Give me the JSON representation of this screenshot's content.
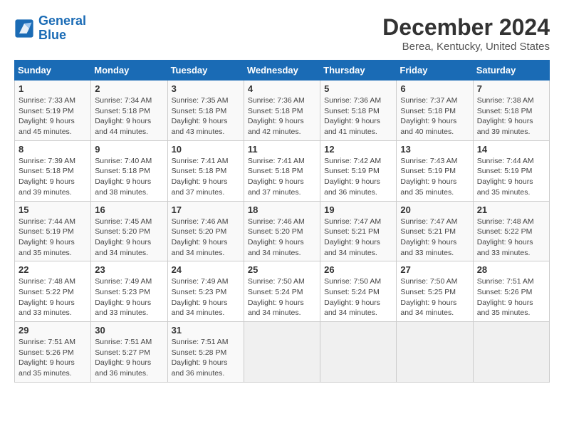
{
  "logo": {
    "line1": "General",
    "line2": "Blue"
  },
  "title": "December 2024",
  "subtitle": "Berea, Kentucky, United States",
  "days_header": [
    "Sunday",
    "Monday",
    "Tuesday",
    "Wednesday",
    "Thursday",
    "Friday",
    "Saturday"
  ],
  "weeks": [
    [
      {
        "day": "1",
        "info": "Sunrise: 7:33 AM\nSunset: 5:19 PM\nDaylight: 9 hours and 45 minutes."
      },
      {
        "day": "2",
        "info": "Sunrise: 7:34 AM\nSunset: 5:18 PM\nDaylight: 9 hours and 44 minutes."
      },
      {
        "day": "3",
        "info": "Sunrise: 7:35 AM\nSunset: 5:18 PM\nDaylight: 9 hours and 43 minutes."
      },
      {
        "day": "4",
        "info": "Sunrise: 7:36 AM\nSunset: 5:18 PM\nDaylight: 9 hours and 42 minutes."
      },
      {
        "day": "5",
        "info": "Sunrise: 7:36 AM\nSunset: 5:18 PM\nDaylight: 9 hours and 41 minutes."
      },
      {
        "day": "6",
        "info": "Sunrise: 7:37 AM\nSunset: 5:18 PM\nDaylight: 9 hours and 40 minutes."
      },
      {
        "day": "7",
        "info": "Sunrise: 7:38 AM\nSunset: 5:18 PM\nDaylight: 9 hours and 39 minutes."
      }
    ],
    [
      {
        "day": "8",
        "info": "Sunrise: 7:39 AM\nSunset: 5:18 PM\nDaylight: 9 hours and 39 minutes."
      },
      {
        "day": "9",
        "info": "Sunrise: 7:40 AM\nSunset: 5:18 PM\nDaylight: 9 hours and 38 minutes."
      },
      {
        "day": "10",
        "info": "Sunrise: 7:41 AM\nSunset: 5:18 PM\nDaylight: 9 hours and 37 minutes."
      },
      {
        "day": "11",
        "info": "Sunrise: 7:41 AM\nSunset: 5:18 PM\nDaylight: 9 hours and 37 minutes."
      },
      {
        "day": "12",
        "info": "Sunrise: 7:42 AM\nSunset: 5:19 PM\nDaylight: 9 hours and 36 minutes."
      },
      {
        "day": "13",
        "info": "Sunrise: 7:43 AM\nSunset: 5:19 PM\nDaylight: 9 hours and 35 minutes."
      },
      {
        "day": "14",
        "info": "Sunrise: 7:44 AM\nSunset: 5:19 PM\nDaylight: 9 hours and 35 minutes."
      }
    ],
    [
      {
        "day": "15",
        "info": "Sunrise: 7:44 AM\nSunset: 5:19 PM\nDaylight: 9 hours and 35 minutes."
      },
      {
        "day": "16",
        "info": "Sunrise: 7:45 AM\nSunset: 5:20 PM\nDaylight: 9 hours and 34 minutes."
      },
      {
        "day": "17",
        "info": "Sunrise: 7:46 AM\nSunset: 5:20 PM\nDaylight: 9 hours and 34 minutes."
      },
      {
        "day": "18",
        "info": "Sunrise: 7:46 AM\nSunset: 5:20 PM\nDaylight: 9 hours and 34 minutes."
      },
      {
        "day": "19",
        "info": "Sunrise: 7:47 AM\nSunset: 5:21 PM\nDaylight: 9 hours and 34 minutes."
      },
      {
        "day": "20",
        "info": "Sunrise: 7:47 AM\nSunset: 5:21 PM\nDaylight: 9 hours and 33 minutes."
      },
      {
        "day": "21",
        "info": "Sunrise: 7:48 AM\nSunset: 5:22 PM\nDaylight: 9 hours and 33 minutes."
      }
    ],
    [
      {
        "day": "22",
        "info": "Sunrise: 7:48 AM\nSunset: 5:22 PM\nDaylight: 9 hours and 33 minutes."
      },
      {
        "day": "23",
        "info": "Sunrise: 7:49 AM\nSunset: 5:23 PM\nDaylight: 9 hours and 33 minutes."
      },
      {
        "day": "24",
        "info": "Sunrise: 7:49 AM\nSunset: 5:23 PM\nDaylight: 9 hours and 34 minutes."
      },
      {
        "day": "25",
        "info": "Sunrise: 7:50 AM\nSunset: 5:24 PM\nDaylight: 9 hours and 34 minutes."
      },
      {
        "day": "26",
        "info": "Sunrise: 7:50 AM\nSunset: 5:24 PM\nDaylight: 9 hours and 34 minutes."
      },
      {
        "day": "27",
        "info": "Sunrise: 7:50 AM\nSunset: 5:25 PM\nDaylight: 9 hours and 34 minutes."
      },
      {
        "day": "28",
        "info": "Sunrise: 7:51 AM\nSunset: 5:26 PM\nDaylight: 9 hours and 35 minutes."
      }
    ],
    [
      {
        "day": "29",
        "info": "Sunrise: 7:51 AM\nSunset: 5:26 PM\nDaylight: 9 hours and 35 minutes."
      },
      {
        "day": "30",
        "info": "Sunrise: 7:51 AM\nSunset: 5:27 PM\nDaylight: 9 hours and 36 minutes."
      },
      {
        "day": "31",
        "info": "Sunrise: 7:51 AM\nSunset: 5:28 PM\nDaylight: 9 hours and 36 minutes."
      },
      {
        "day": "",
        "info": ""
      },
      {
        "day": "",
        "info": ""
      },
      {
        "day": "",
        "info": ""
      },
      {
        "day": "",
        "info": ""
      }
    ]
  ]
}
